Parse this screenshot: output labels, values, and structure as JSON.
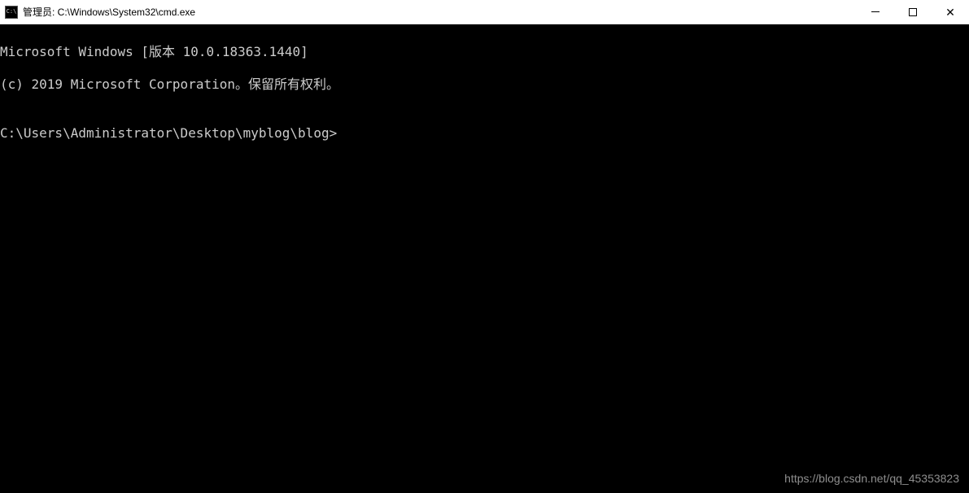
{
  "window": {
    "icon_label": "C:\\",
    "title": "管理员: C:\\Windows\\System32\\cmd.exe"
  },
  "terminal": {
    "line1": "Microsoft Windows [版本 10.0.18363.1440]",
    "line2": "(c) 2019 Microsoft Corporation。保留所有权利。",
    "blank": "",
    "prompt": "C:\\Users\\Administrator\\Desktop\\myblog\\blog>"
  },
  "watermark": "https://blog.csdn.net/qq_45353823"
}
